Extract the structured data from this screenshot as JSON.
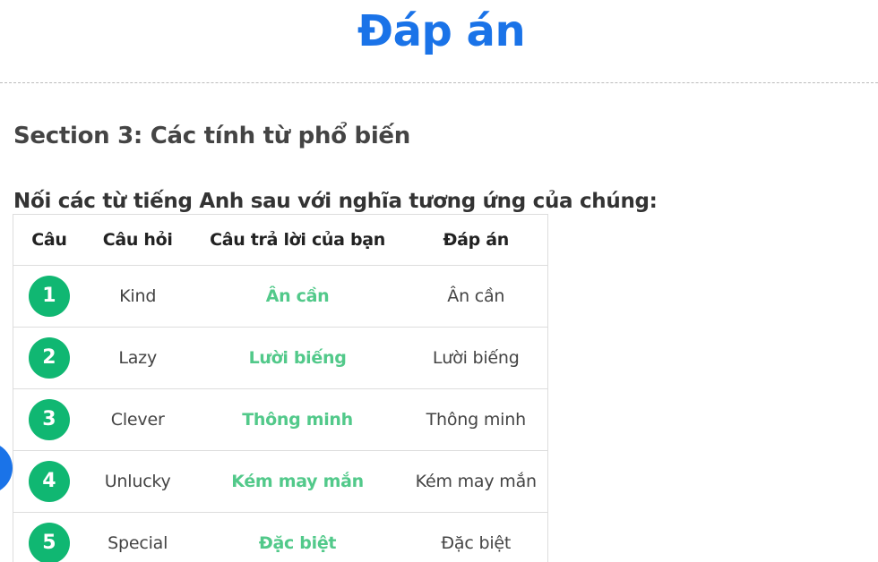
{
  "header": {
    "title": "Đáp án"
  },
  "section": {
    "title": "Section 3: Các tính từ phổ biến",
    "instruction": "Nối các từ tiếng Anh sau với nghĩa tương ứng của chúng:"
  },
  "table": {
    "headers": {
      "number": "Câu",
      "question": "Câu hỏi",
      "your_answer": "Câu trả lời của bạn",
      "correct_answer": "Đáp án"
    },
    "rows": [
      {
        "number": "1",
        "question": "Kind",
        "your_answer": "Ân cần",
        "correct_answer": "Ân cần"
      },
      {
        "number": "2",
        "question": "Lazy",
        "your_answer": "Lười biếng",
        "correct_answer": "Lười biếng"
      },
      {
        "number": "3",
        "question": "Clever",
        "your_answer": "Thông minh",
        "correct_answer": "Thông minh"
      },
      {
        "number": "4",
        "question": "Unlucky",
        "your_answer": "Kém may mắn",
        "correct_answer": "Kém may mắn"
      },
      {
        "number": "5",
        "question": "Special",
        "your_answer": "Đặc biệt",
        "correct_answer": "Đặc biệt"
      }
    ]
  },
  "colors": {
    "title_blue": "#1a73e8",
    "badge_green": "#10b772",
    "answer_green": "#52c98a"
  }
}
